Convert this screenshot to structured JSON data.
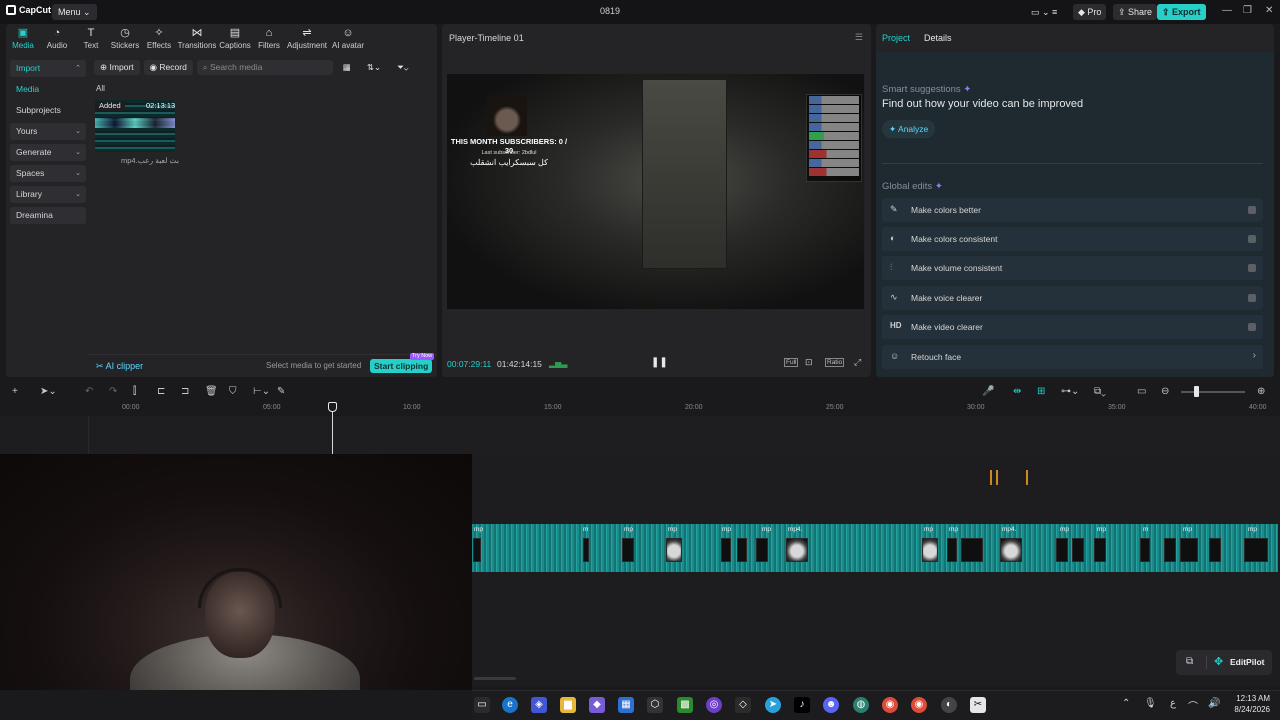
{
  "titlebar": {
    "app_name": "CapCut",
    "menu_label": "Menu",
    "menu_chevron": "⌄",
    "project_name": "0819",
    "pro_label": "Pro",
    "share_label": "Share",
    "export_label": "Export"
  },
  "toolbar": {
    "tools": [
      {
        "icon": "media-icon",
        "glyph": "▣",
        "label": "Media"
      },
      {
        "icon": "audio-icon",
        "glyph": "◔",
        "label": "Audio"
      },
      {
        "icon": "text-icon",
        "glyph": "T",
        "label": "Text"
      },
      {
        "icon": "stickers-icon",
        "glyph": "◷",
        "label": "Stickers"
      },
      {
        "icon": "effects-icon",
        "glyph": "✧",
        "label": "Effects"
      },
      {
        "icon": "transitions-icon",
        "glyph": "⋈",
        "label": "Transitions"
      },
      {
        "icon": "captions-icon",
        "glyph": "▤",
        "label": "Captions"
      },
      {
        "icon": "filters-icon",
        "glyph": "⌂",
        "label": "Filters"
      },
      {
        "icon": "adjustment-icon",
        "glyph": "⇌",
        "label": "Adjustment"
      },
      {
        "icon": "ai-avatar-icon",
        "glyph": "☺",
        "label": "AI avatar"
      }
    ]
  },
  "sidebar": {
    "items": [
      {
        "label": "Import",
        "chevron": "⌃"
      },
      {
        "label": "Media",
        "chevron": ""
      },
      {
        "label": "Subprojects",
        "chevron": ""
      },
      {
        "label": "Yours",
        "chevron": "⌄"
      },
      {
        "label": "Generate",
        "chevron": "⌄"
      },
      {
        "label": "Spaces",
        "chevron": "⌄"
      },
      {
        "label": "Library",
        "chevron": "⌄"
      },
      {
        "label": "Dreamina",
        "chevron": ""
      }
    ]
  },
  "media": {
    "import_label": "Import",
    "record_label": "Record",
    "search_placeholder": "Search media",
    "filter_all": "All",
    "items": [
      {
        "badge": "Added",
        "duration": "02:13:13",
        "name": "mp4.بث لعبة رعب"
      }
    ]
  },
  "clipper": {
    "label": "AI clipper",
    "hint": "Select media to get started",
    "button": "Start clipping",
    "badge": "Try Now"
  },
  "player": {
    "title": "Player-Timeline 01",
    "current_time": "00:07:29:11",
    "total_time": "01:42:14:15",
    "overlay_line1": "THIS MONTH SUBSCRIBERS: 0 / 30",
    "overlay_line2": "Last subscriber: 2bdlul",
    "overlay_line3": "كل سبسكرايب انشقلب",
    "ratio_label": "Ratio",
    "full_label": "Full",
    "pause_glyph": "❚❚"
  },
  "right_panel": {
    "tabs": [
      "Project",
      "Details"
    ],
    "smart_title": "Smart suggestions",
    "smart_heading": "Find out how your video can be improved",
    "analyze_label": "Analyze",
    "global_title": "Global edits",
    "edits": [
      {
        "icon": "magic-wand-icon",
        "glyph": "✎",
        "label": "Make colors better"
      },
      {
        "icon": "palette-icon",
        "glyph": "◐",
        "label": "Make colors consistent"
      },
      {
        "icon": "volume-sliders-icon",
        "glyph": "⫶",
        "label": "Make volume consistent"
      },
      {
        "icon": "voice-wave-icon",
        "glyph": "∿",
        "label": "Make voice clearer"
      },
      {
        "icon": "hd-icon",
        "glyph": "HD",
        "label": "Make video clearer"
      },
      {
        "icon": "retouch-face-icon",
        "glyph": "☺",
        "label": "Retouch face"
      }
    ]
  },
  "timeline": {
    "ticks": [
      "00:00",
      "05:00",
      "10:00",
      "15:00",
      "20:00",
      "25:00",
      "30:00",
      "35:00",
      "40:00"
    ],
    "clip_label": "mp4.",
    "clip_short": "mp",
    "clip_tiny": "m"
  },
  "editpilot": {
    "label": "EditPilot"
  },
  "taskbar": {
    "time": "12:13 AM",
    "date": "8/24/2026",
    "lang": "ع"
  },
  "colors": {
    "accent": "#26d0c9",
    "clipper": "#5fd7ff",
    "panel": "#242427"
  }
}
